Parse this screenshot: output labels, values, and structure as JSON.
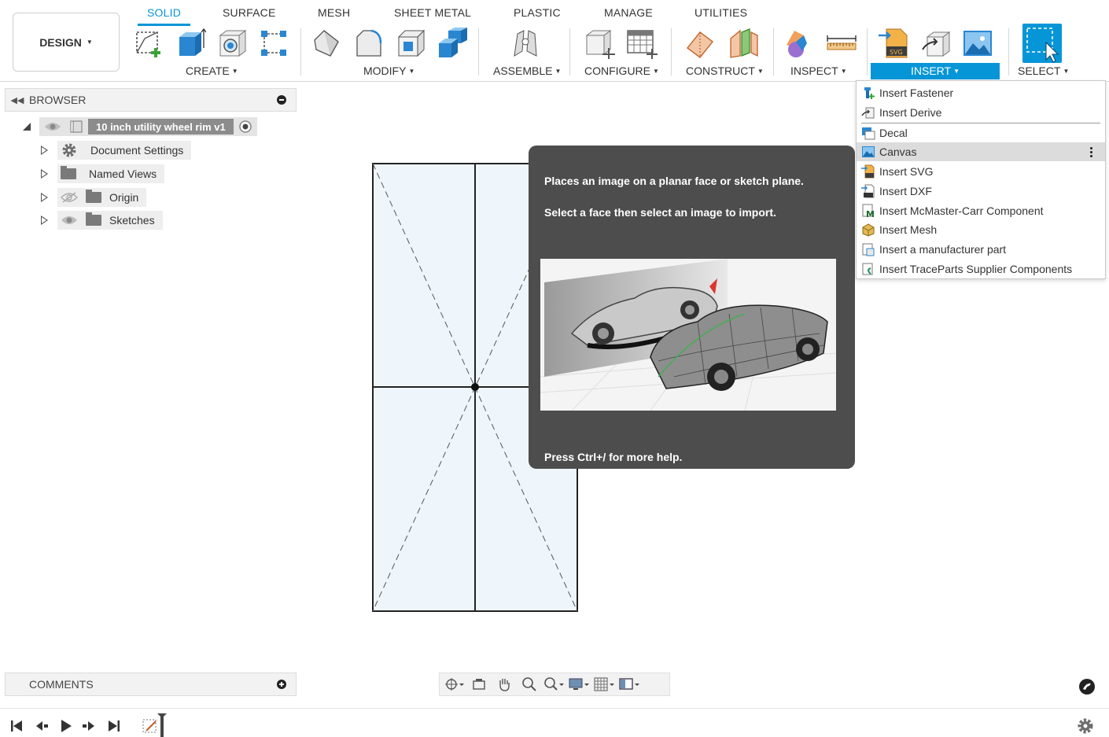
{
  "workspace": {
    "label": "DESIGN"
  },
  "tabs": [
    {
      "label": "SOLID",
      "active": true
    },
    {
      "label": "SURFACE"
    },
    {
      "label": "MESH"
    },
    {
      "label": "SHEET METAL"
    },
    {
      "label": "PLASTIC"
    },
    {
      "label": "MANAGE"
    },
    {
      "label": "UTILITIES"
    }
  ],
  "groups": {
    "create": "CREATE",
    "modify": "MODIFY",
    "assemble": "ASSEMBLE",
    "configure": "CONFIGURE",
    "construct": "CONSTRUCT",
    "inspect": "INSPECT",
    "insert": "INSERT",
    "select": "SELECT"
  },
  "browser": {
    "title": "BROWSER",
    "root": "10 inch utility wheel rim v1",
    "items": [
      {
        "label": "Document Settings",
        "icon": "gear-icon"
      },
      {
        "label": "Named Views",
        "icon": "folder-icon"
      },
      {
        "label": "Origin",
        "icon": "folder-icon",
        "visibility": "hidden"
      },
      {
        "label": "Sketches",
        "icon": "folder-icon",
        "visibility": "visible"
      }
    ]
  },
  "comments": {
    "title": "COMMENTS"
  },
  "insert_menu": {
    "items": [
      {
        "label": "Insert Fastener"
      },
      {
        "label": "Insert Derive"
      },
      {
        "label": "Decal"
      },
      {
        "label": "Canvas",
        "highlighted": true
      },
      {
        "label": "Insert SVG"
      },
      {
        "label": "Insert DXF"
      },
      {
        "label": "Insert McMaster-Carr Component"
      },
      {
        "label": "Insert Mesh"
      },
      {
        "label": "Insert a manufacturer part"
      },
      {
        "label": "Insert TraceParts Supplier Components"
      }
    ]
  },
  "tooltip": {
    "line1": "Places an image on a planar face or sketch plane.",
    "line2": "Select a face then select an image to import.",
    "help": "Press Ctrl+/ for more help."
  },
  "colors": {
    "accent": "#0696d7",
    "tooltip_bg": "#4d4d4d"
  }
}
